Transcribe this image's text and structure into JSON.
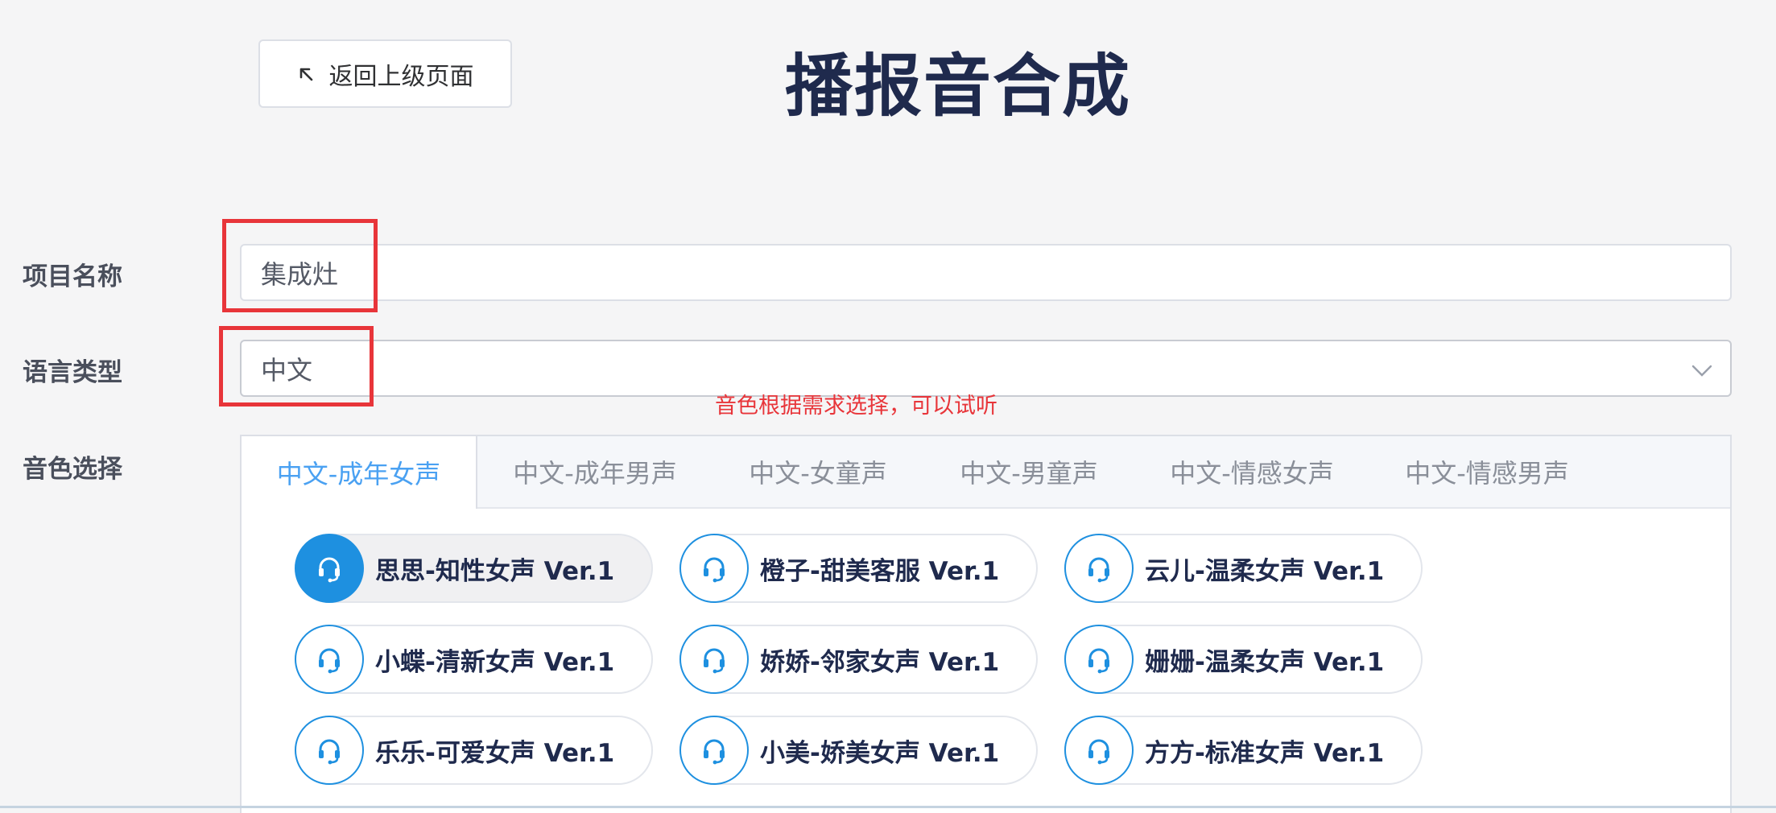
{
  "header": {
    "back_label": "返回上级页面",
    "title": "播报音合成"
  },
  "form": {
    "project_name_label": "项目名称",
    "project_name_value": "集成灶",
    "language_label": "语言类型",
    "language_value": "中文",
    "voice_label": "音色选择"
  },
  "annotation": {
    "hint": "音色根据需求选择，可以试听",
    "color": "#e8353a"
  },
  "tabs": [
    {
      "label": "中文-成年女声",
      "active": true
    },
    {
      "label": "中文-成年男声",
      "active": false
    },
    {
      "label": "中文-女童声",
      "active": false
    },
    {
      "label": "中文-男童声",
      "active": false
    },
    {
      "label": "中文-情感女声",
      "active": false
    },
    {
      "label": "中文-情感男声",
      "active": false
    }
  ],
  "voices": [
    {
      "name": "思思-知性女声 Ver.1",
      "selected": true
    },
    {
      "name": "橙子-甜美客服 Ver.1",
      "selected": false
    },
    {
      "name": "云儿-温柔女声 Ver.1",
      "selected": false
    },
    {
      "name": "小蝶-清新女声 Ver.1",
      "selected": false
    },
    {
      "name": "娇娇-邻家女声 Ver.1",
      "selected": false
    },
    {
      "name": "姗姗-温柔女声 Ver.1",
      "selected": false
    },
    {
      "name": "乐乐-可爱女声 Ver.1",
      "selected": false
    },
    {
      "name": "小美-娇美女声 Ver.1",
      "selected": false
    },
    {
      "name": "方方-标准女声 Ver.1",
      "selected": false
    }
  ],
  "icons": {
    "back": "arrow-up-left-icon",
    "select": "chevron-down-icon",
    "voice": "headset-icon"
  },
  "colors": {
    "accent": "#1e90e0",
    "active_tab": "#4aa1f2",
    "title": "#1f2a4d"
  }
}
